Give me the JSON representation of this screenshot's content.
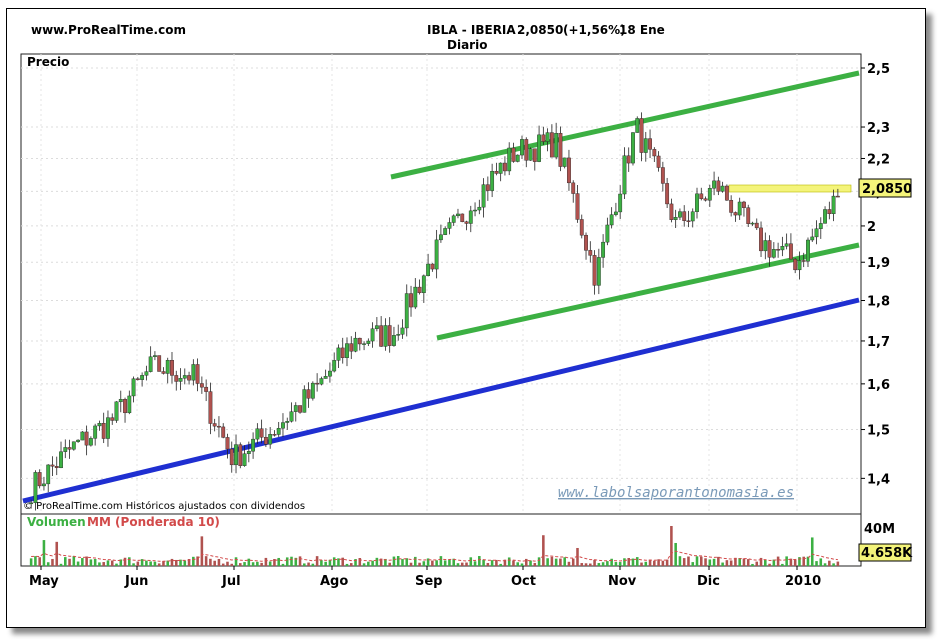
{
  "header": {
    "site": "www.ProRealTime.com",
    "ticker": "IBLA - IBERIA",
    "price": "2,0850",
    "change": "(+1,56%)",
    "date": "18 Ene",
    "period": "Diario"
  },
  "panels": {
    "price_label": "Precio",
    "footer_credit": "© ProRealTime.com  Históricos ajustados con dividendos",
    "watermark": "www.labolsaporantonomasia.es",
    "volume_label": "Volumen",
    "ma_label": "MM (Ponderada 10)",
    "last_price_badge": "2,0850",
    "volume_top_tick": "40M",
    "last_volume_badge": "4.658K"
  },
  "colors": {
    "up": "#3cb043",
    "down": "#b0524f",
    "channel": "#3cb043",
    "support": "#1f2fd1",
    "resistance": "#f4f47a",
    "ma": "#d24a4a"
  },
  "chart_data": {
    "type": "candlestick",
    "x_ticks": [
      "May",
      "Jun",
      "Jul",
      "Ago",
      "Sep",
      "Oct",
      "Nov",
      "Dic",
      "2010"
    ],
    "y_ticks": [
      "1,4",
      "1,5",
      "1,6",
      "1,7",
      "1,8",
      "1,9",
      "2",
      "2,1",
      "2,2",
      "2,3",
      "2,5"
    ],
    "ylim": [
      1.32,
      2.55
    ],
    "y_scale": "log",
    "approx_close_path": [
      [
        "May",
        1.38
      ],
      [
        "May",
        1.46
      ],
      [
        "May",
        1.52
      ],
      [
        "Jun",
        1.64
      ],
      [
        "Jun",
        1.62
      ],
      [
        "Jul",
        1.44
      ],
      [
        "Jul",
        1.5
      ],
      [
        "Ago",
        1.58
      ],
      [
        "Ago",
        1.7
      ],
      [
        "Sep",
        1.72
      ],
      [
        "Sep",
        1.92
      ],
      [
        "Oct",
        2.08
      ],
      [
        "Oct",
        2.22
      ],
      [
        "Oct",
        2.25
      ],
      [
        "Nov",
        1.86
      ],
      [
        "Nov",
        2.3
      ],
      [
        "Nov",
        2.0
      ],
      [
        "Dic",
        2.12
      ],
      [
        "Dic",
        1.96
      ],
      [
        "2010",
        1.9
      ],
      [
        "2010",
        2.085
      ]
    ],
    "last_close": 2.085,
    "volume_axis": [
      "40M"
    ],
    "last_volume": "4.658K"
  }
}
